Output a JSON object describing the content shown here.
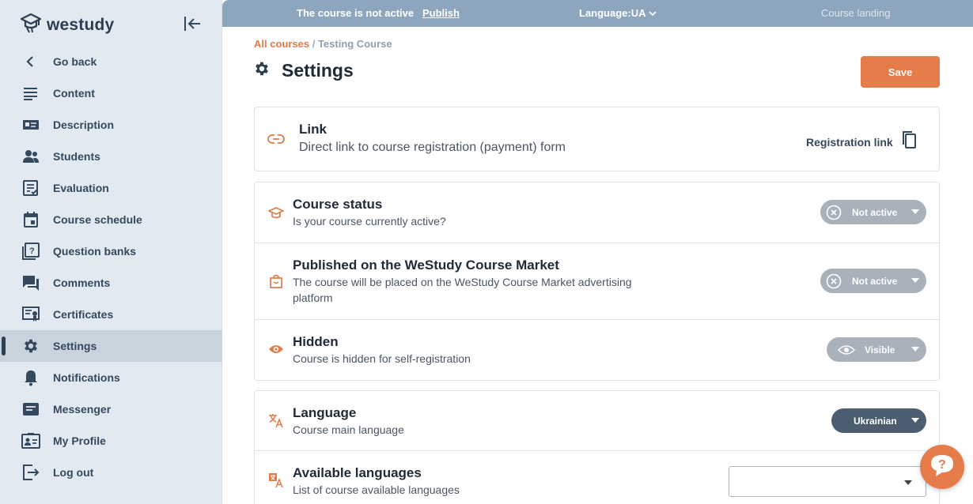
{
  "app": {
    "name": "westudy"
  },
  "sidebar": {
    "items": [
      {
        "label": "Go back",
        "icon": "chevron-left-icon"
      },
      {
        "label": "Content",
        "icon": "list-icon"
      },
      {
        "label": "Description",
        "icon": "id-card-icon"
      },
      {
        "label": "Students",
        "icon": "people-icon"
      },
      {
        "label": "Evaluation",
        "icon": "checklist-icon"
      },
      {
        "label": "Course schedule",
        "icon": "calendar-icon"
      },
      {
        "label": "Question banks",
        "icon": "question-bank-icon"
      },
      {
        "label": "Comments",
        "icon": "comments-icon"
      },
      {
        "label": "Certificates",
        "icon": "certificate-icon"
      },
      {
        "label": "Settings",
        "icon": "gear-icon",
        "active": true
      },
      {
        "label": "Notifications",
        "icon": "bell-icon"
      },
      {
        "label": "Messenger",
        "icon": "message-icon"
      },
      {
        "label": "My Profile",
        "icon": "profile-icon"
      },
      {
        "label": "Log out",
        "icon": "logout-icon"
      }
    ]
  },
  "topbar": {
    "status_text": "The course is not active",
    "publish_label": "Publish",
    "language_label": "Language:UA",
    "landing_label": "Course landing"
  },
  "breadcrumb": {
    "root": "All courses",
    "separator": " / ",
    "current": "Testing Course"
  },
  "page": {
    "title": "Settings",
    "save_label": "Save"
  },
  "link_card": {
    "title": "Link",
    "subtitle": "Direct link to course registration (payment) form",
    "action_label": "Registration link"
  },
  "status_card": {
    "course_status": {
      "title": "Course status",
      "subtitle": "Is your course currently active?",
      "value": "Not active"
    },
    "market": {
      "title": "Published on the WeStudy Course Market",
      "subtitle": "The course will be placed on the WeStudy Course Market advertising platform",
      "value": "Not active"
    },
    "hidden": {
      "title": "Hidden",
      "subtitle": "Course is hidden for self-registration",
      "value": "Visible"
    }
  },
  "language_card": {
    "language": {
      "title": "Language",
      "subtitle": "Course main language",
      "value": "Ukrainian"
    },
    "available": {
      "title": "Available languages",
      "subtitle": "List of course available languages",
      "value": ""
    }
  },
  "colors": {
    "accent": "#e77c4b",
    "topbar": "#8ea6bd",
    "sidebar": "#e3e9f0",
    "pill": "#a9b1ba",
    "pill_dark": "#4c5d70"
  }
}
